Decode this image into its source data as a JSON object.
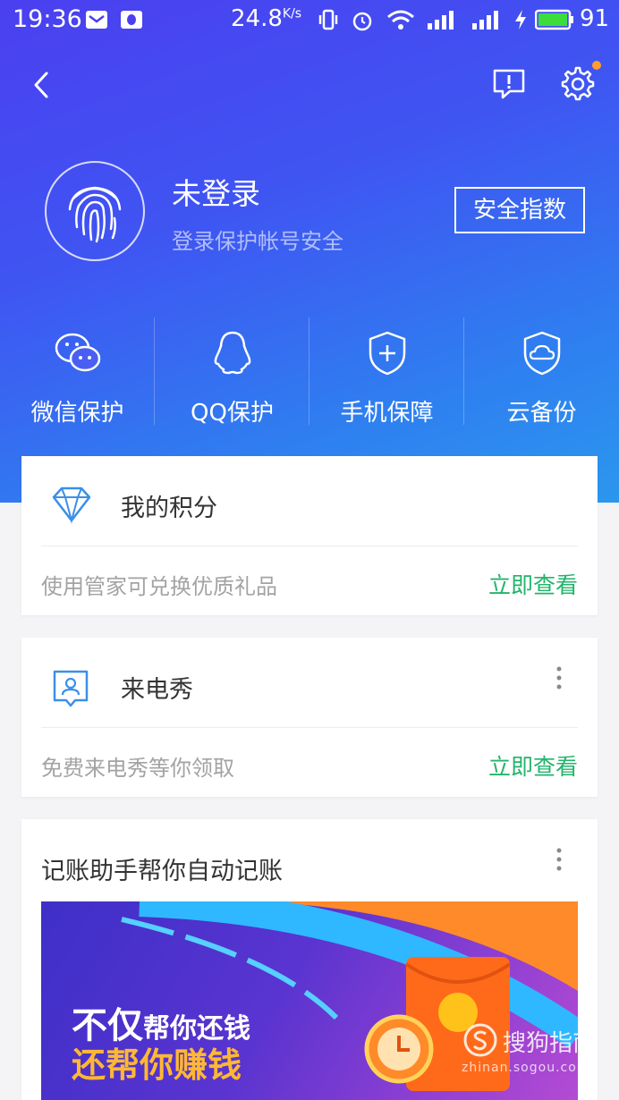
{
  "status_bar": {
    "time": "19:36",
    "net_speed": "24.8",
    "net_speed_unit": "K/s",
    "battery_percent": "91",
    "icons": [
      "mail-icon",
      "qq-notify-icon",
      "vibrate-icon",
      "alarm-icon",
      "wifi-icon",
      "signal-icon",
      "signal-icon",
      "charging-icon",
      "battery-icon"
    ]
  },
  "header": {
    "back_icon": "chevron-left-icon",
    "feedback_icon": "feedback-icon",
    "settings_icon": "gear-icon",
    "notification_dot_color": "#ff9e2c"
  },
  "profile": {
    "avatar_icon": "fingerprint-icon",
    "name": "未登录",
    "subtitle": "登录保护帐号安全",
    "safety_button": "安全指数"
  },
  "quick_actions": [
    {
      "label": "微信保护",
      "icon": "wechat-icon"
    },
    {
      "label": "QQ保护",
      "icon": "qq-icon"
    },
    {
      "label": "手机保障",
      "icon": "shield-plus-icon"
    },
    {
      "label": "云备份",
      "icon": "cloud-shield-icon"
    }
  ],
  "cards": {
    "points": {
      "title": "我的积分",
      "icon": "diamond-icon",
      "subtitle": "使用管家可兑换优质礼品",
      "action": "立即查看"
    },
    "caller_show": {
      "title": "来电秀",
      "icon": "caller-id-icon",
      "subtitle": "免费来电秀等你领取",
      "action": "立即查看"
    },
    "bookkeeping": {
      "title": "记账助手帮你自动记账",
      "banner_line1_big": "不仅",
      "banner_line1_small": "帮你还钱",
      "banner_line2": "还帮你赚钱"
    }
  },
  "watermark": {
    "text": "搜狗指南",
    "url": "zhinan.sogou.com"
  },
  "colors": {
    "accent_green": "#22b46b",
    "hero_gradient_start": "#4b3ff0",
    "hero_gradient_end": "#2b97ee",
    "icon_blue": "#3b8fe8"
  }
}
